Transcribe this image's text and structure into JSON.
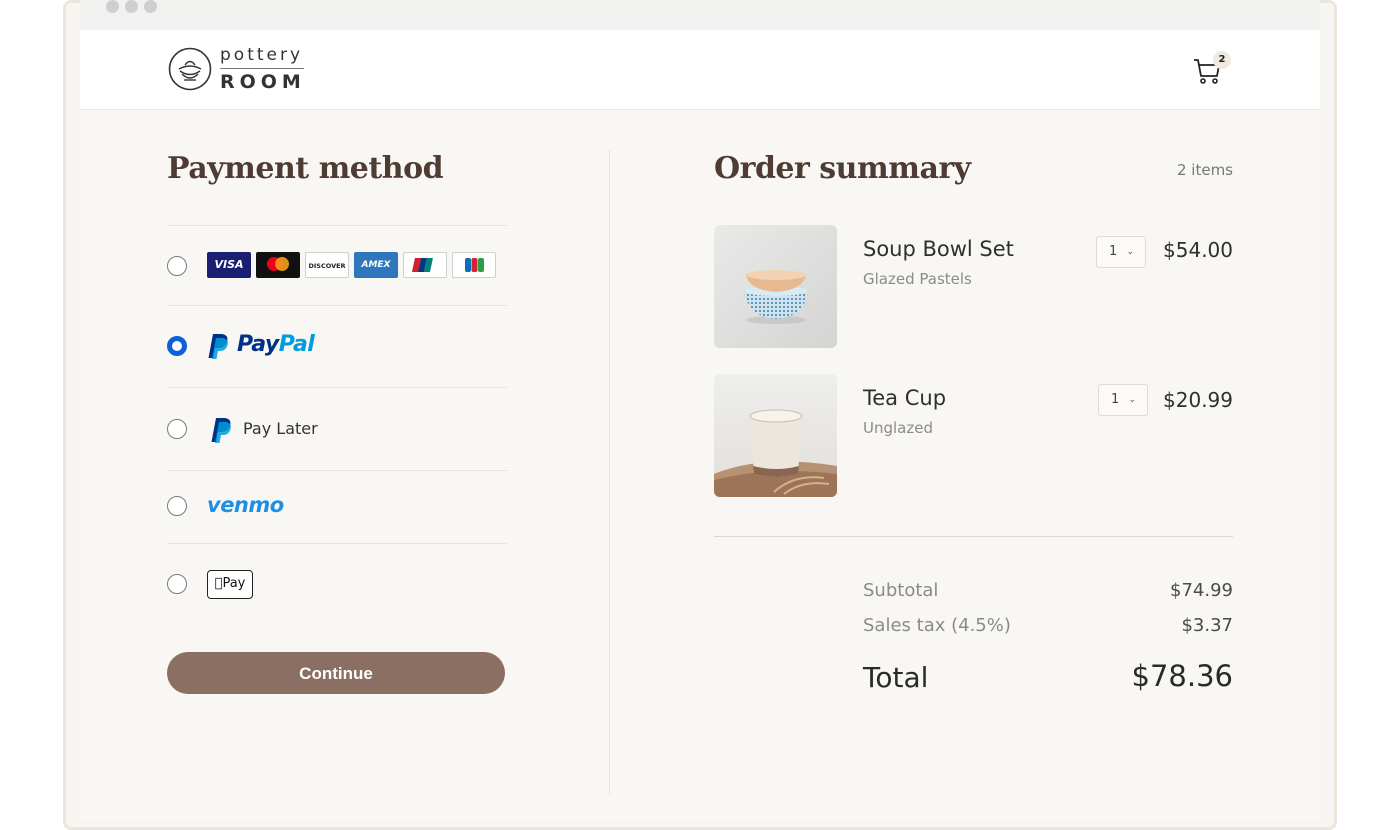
{
  "brand": {
    "line1": "pottery",
    "line2": "ROOM"
  },
  "cart": {
    "count": "2"
  },
  "payment": {
    "title": "Payment method",
    "selected": "paypal",
    "cards": [
      "VISA",
      "mastercard",
      "DISCOVER",
      "AMEX",
      "UnionPay",
      "JCB"
    ],
    "paypal_label": "PayPal",
    "paylater_label": "Pay Later",
    "venmo_label": "venmo",
    "applepay_label": "Pay",
    "continue_label": "Continue"
  },
  "order": {
    "title": "Order summary",
    "item_count": "2 items",
    "items": [
      {
        "name": "Soup Bowl Set",
        "variant": "Glazed Pastels",
        "qty": "1",
        "price": "$54.00"
      },
      {
        "name": "Tea Cup",
        "variant": "Unglazed",
        "qty": "1",
        "price": "$20.99"
      }
    ],
    "subtotal_label": "Subtotal",
    "subtotal": "$74.99",
    "tax_label": "Sales tax (4.5%)",
    "tax": "$3.37",
    "total_label": "Total",
    "total": "$78.36"
  },
  "colors": {
    "accent_button": "#8a6f62",
    "heading": "#4e3b33",
    "radio_selected": "#0f5fd8",
    "paypal_dark": "#003087",
    "paypal_light": "#009cde",
    "venmo": "#1f8fe4"
  }
}
